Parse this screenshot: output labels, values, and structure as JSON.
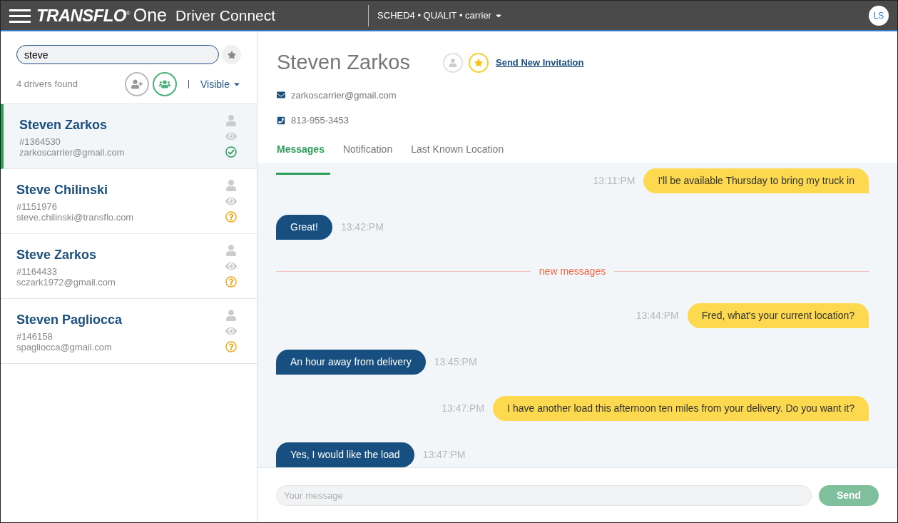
{
  "app": {
    "brand": "TRANSFLO",
    "brand_mark": "®",
    "brand_suffix": "One",
    "title": "Driver Connect",
    "account": "SCHED4 • QUALIT • carrier",
    "avatar": "LS"
  },
  "search": {
    "value": "steve"
  },
  "results": {
    "count": "4 drivers found",
    "filter": "Visible"
  },
  "drivers": [
    {
      "name": "Steven Zarkos",
      "id": "#1364530",
      "email": "zarkoscarrier@gmail.com",
      "verified": true,
      "selected": true
    },
    {
      "name": "Steve Chilinski",
      "id": "#1151976",
      "email": "steve.chilinski@transflo.com",
      "verified": false,
      "selected": false
    },
    {
      "name": "Steve Zarkos",
      "id": "#1164433",
      "email": "sczark1972@gmail.com",
      "verified": false,
      "selected": false
    },
    {
      "name": "Steven Pagliocca",
      "id": "#146158",
      "email": "spagliocca@gmail.com",
      "verified": false,
      "selected": false
    }
  ],
  "profile": {
    "name": "Steven Zarkos",
    "favorite": true,
    "invite_link": "Send New Invitation",
    "email": "zarkoscarrier@gmail.com",
    "phone": "813-955-3453"
  },
  "tabs": [
    {
      "label": "Messages",
      "selected": true
    },
    {
      "label": "Notification",
      "selected": false
    },
    {
      "label": "Last Known Location",
      "selected": false
    }
  ],
  "messages": [
    {
      "kind": "outgoing",
      "text": "I'll be available Thursday to bring my truck in",
      "time": "13:11:PM"
    },
    {
      "kind": "incoming",
      "text": "Great!",
      "time": "13:42:PM"
    },
    {
      "kind": "divider",
      "text": "new messages"
    },
    {
      "kind": "outgoing",
      "text": "Fred, what's your current location?",
      "time": "13:44:PM"
    },
    {
      "kind": "incoming",
      "text": "An hour away from delivery",
      "time": "13:45:PM"
    },
    {
      "kind": "outgoing",
      "text": "I have another load this afternoon ten miles from your delivery. Do you want it?",
      "time": "13:47:PM"
    },
    {
      "kind": "incoming",
      "text": "Yes, I would like the load",
      "time": "13:47:PM"
    }
  ],
  "composer": {
    "placeholder": "Your message",
    "send": "Send",
    "send_disabled": true
  }
}
